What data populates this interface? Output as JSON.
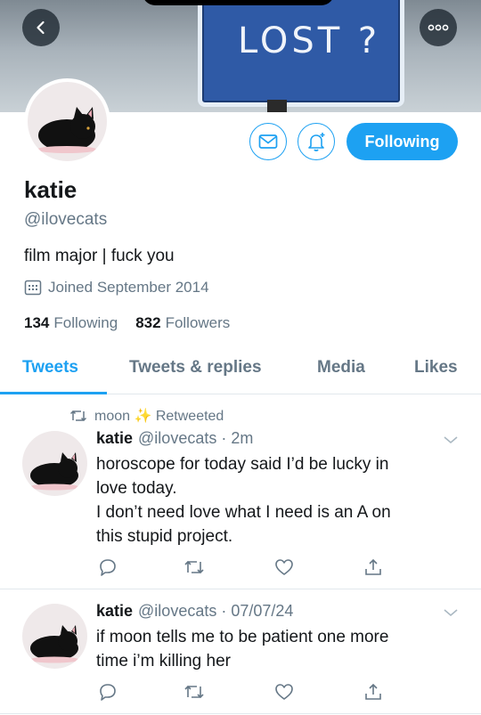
{
  "banner": {
    "sign_text": "LOST ?"
  },
  "profile": {
    "name": "katie",
    "handle": "@ilovecats",
    "bio": "film major | fuck you",
    "joined": "Joined September 2014",
    "following_count": "134",
    "following_label": "Following",
    "followers_count": "832",
    "followers_label": "Followers",
    "follow_button": "Following"
  },
  "tabs": [
    "Tweets",
    "Tweets & replies",
    "Media",
    "Likes"
  ],
  "tweets": [
    {
      "retweet_label": "moon ✨ Retweeted",
      "name": "katie",
      "meta": "@ilovecats · 2m",
      "lines": [
        "horoscope for today said I’d be lucky in",
        "love today.",
        "I don’t need love what I need is an A on",
        "this stupid project."
      ]
    },
    {
      "name": "katie",
      "meta": "@ilovecats · 07/07/24",
      "lines": [
        "if moon tells me to be patient one more",
        "time i’m killing her"
      ]
    }
  ],
  "colors": {
    "accent": "#1da1f2",
    "muted": "#657786",
    "text": "#14171a",
    "divider": "#e1e8ed"
  },
  "icons": [
    "back-arrow-icon",
    "more-icon",
    "mail-icon",
    "bell-plus-icon",
    "calendar-icon",
    "retweet-icon",
    "chevron-down-icon",
    "reply-icon",
    "heart-icon",
    "share-icon"
  ]
}
